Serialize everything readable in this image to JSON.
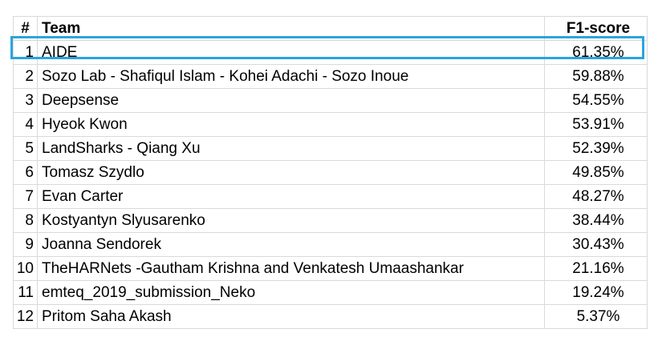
{
  "table": {
    "headers": {
      "rank": "#",
      "team": "Team",
      "score": "F1-score"
    },
    "rows": [
      {
        "rank": "1",
        "team": "AIDE",
        "score": "61.35%"
      },
      {
        "rank": "2",
        "team": "Sozo Lab - Shafiqul Islam - Kohei Adachi - Sozo Inoue",
        "score": "59.88%"
      },
      {
        "rank": "3",
        "team": "Deepsense",
        "score": "54.55%"
      },
      {
        "rank": "4",
        "team": "Hyeok Kwon",
        "score": "53.91%"
      },
      {
        "rank": "5",
        "team": "LandSharks - Qiang Xu",
        "score": "52.39%"
      },
      {
        "rank": "6",
        "team": "Tomasz Szydlo",
        "score": "49.85%"
      },
      {
        "rank": "7",
        "team": "Evan Carter",
        "score": "48.27%"
      },
      {
        "rank": "8",
        "team": "Kostyantyn Slyusarenko",
        "score": "38.44%"
      },
      {
        "rank": "9",
        "team": "Joanna Sendorek",
        "score": "30.43%"
      },
      {
        "rank": "10",
        "team": "TheHARNets -Gautham Krishna and Venkatesh Umaashankar",
        "score": "21.16%"
      },
      {
        "rank": "11",
        "team": "emteq_2019_submission_Neko",
        "score": "19.24%"
      },
      {
        "rank": "12",
        "team": "Pritom Saha Akash",
        "score": "5.37%"
      }
    ],
    "highlighted_rank": "1"
  },
  "colors": {
    "highlight_border": "#2aa5db",
    "grid_line": "#d9d9d9",
    "text": "#000000",
    "background": "#ffffff"
  }
}
